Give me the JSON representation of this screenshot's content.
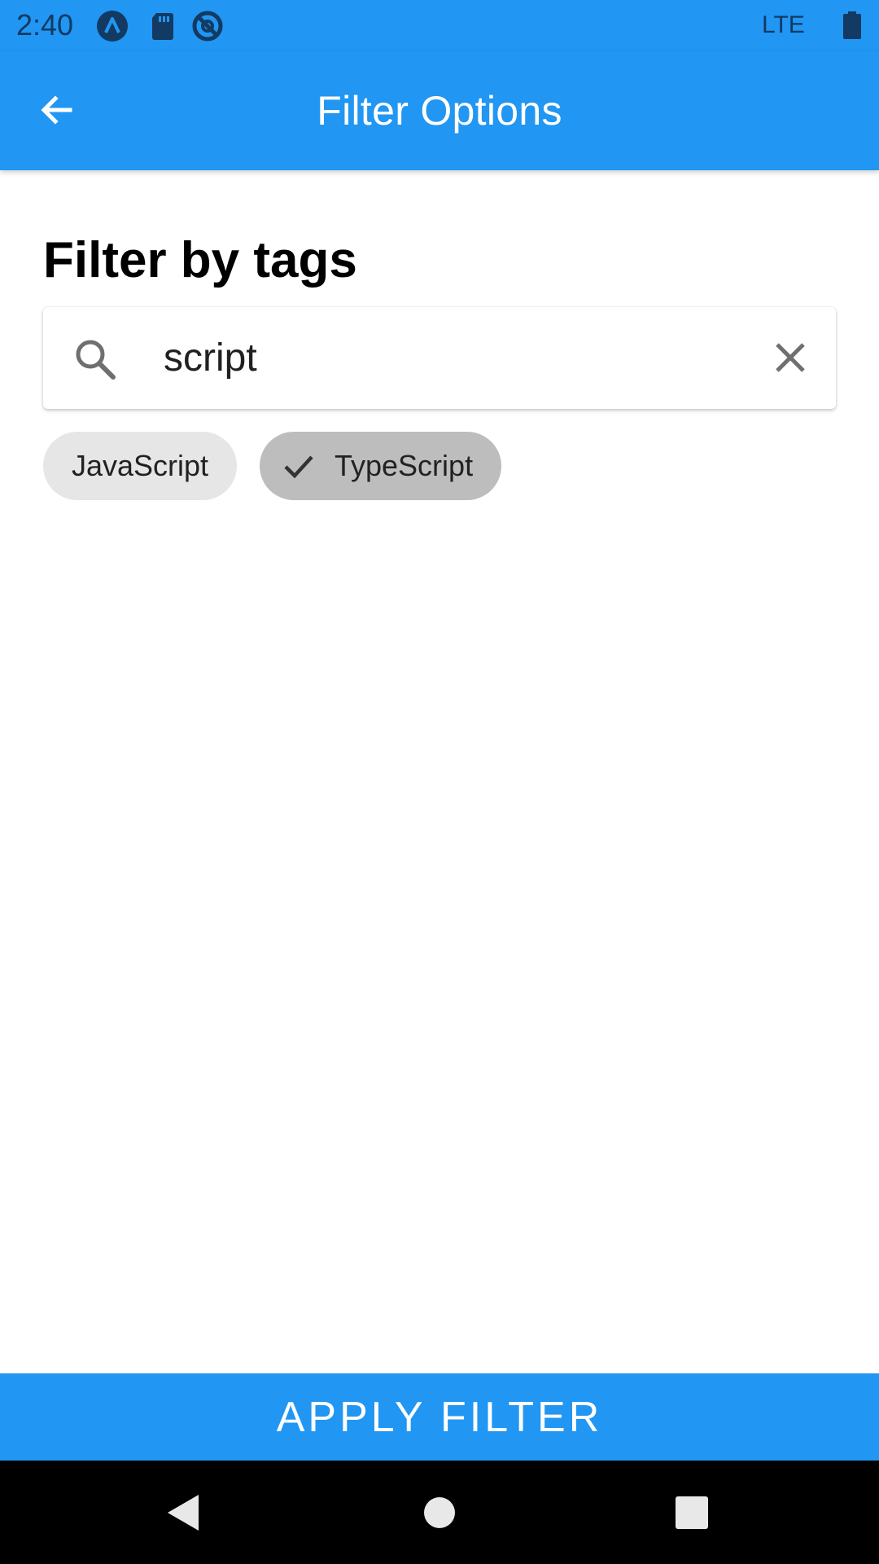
{
  "status_bar": {
    "time": "2:40",
    "network": "LTE",
    "icons": [
      "app-notification-icon",
      "sd-card-icon",
      "do-not-disturb-icon",
      "battery-icon"
    ]
  },
  "app_bar": {
    "title": "Filter Options",
    "back_icon": "arrow-back-icon"
  },
  "content": {
    "section_title": "Filter by tags",
    "search": {
      "value": "script",
      "icons": [
        "search-icon",
        "clear-icon"
      ]
    },
    "chips": [
      {
        "label": "JavaScript",
        "selected": false
      },
      {
        "label": "TypeScript",
        "selected": true
      }
    ]
  },
  "apply_button": {
    "label": "APPLY FILTER"
  },
  "nav_bar": {
    "icons": [
      "back-triangle-icon",
      "home-circle-icon",
      "recents-square-icon"
    ]
  },
  "colors": {
    "primary": "#2196F3",
    "chip_unselected": "#E6E6E6",
    "chip_selected": "#BDBDBD",
    "nav_bar": "#000000"
  }
}
